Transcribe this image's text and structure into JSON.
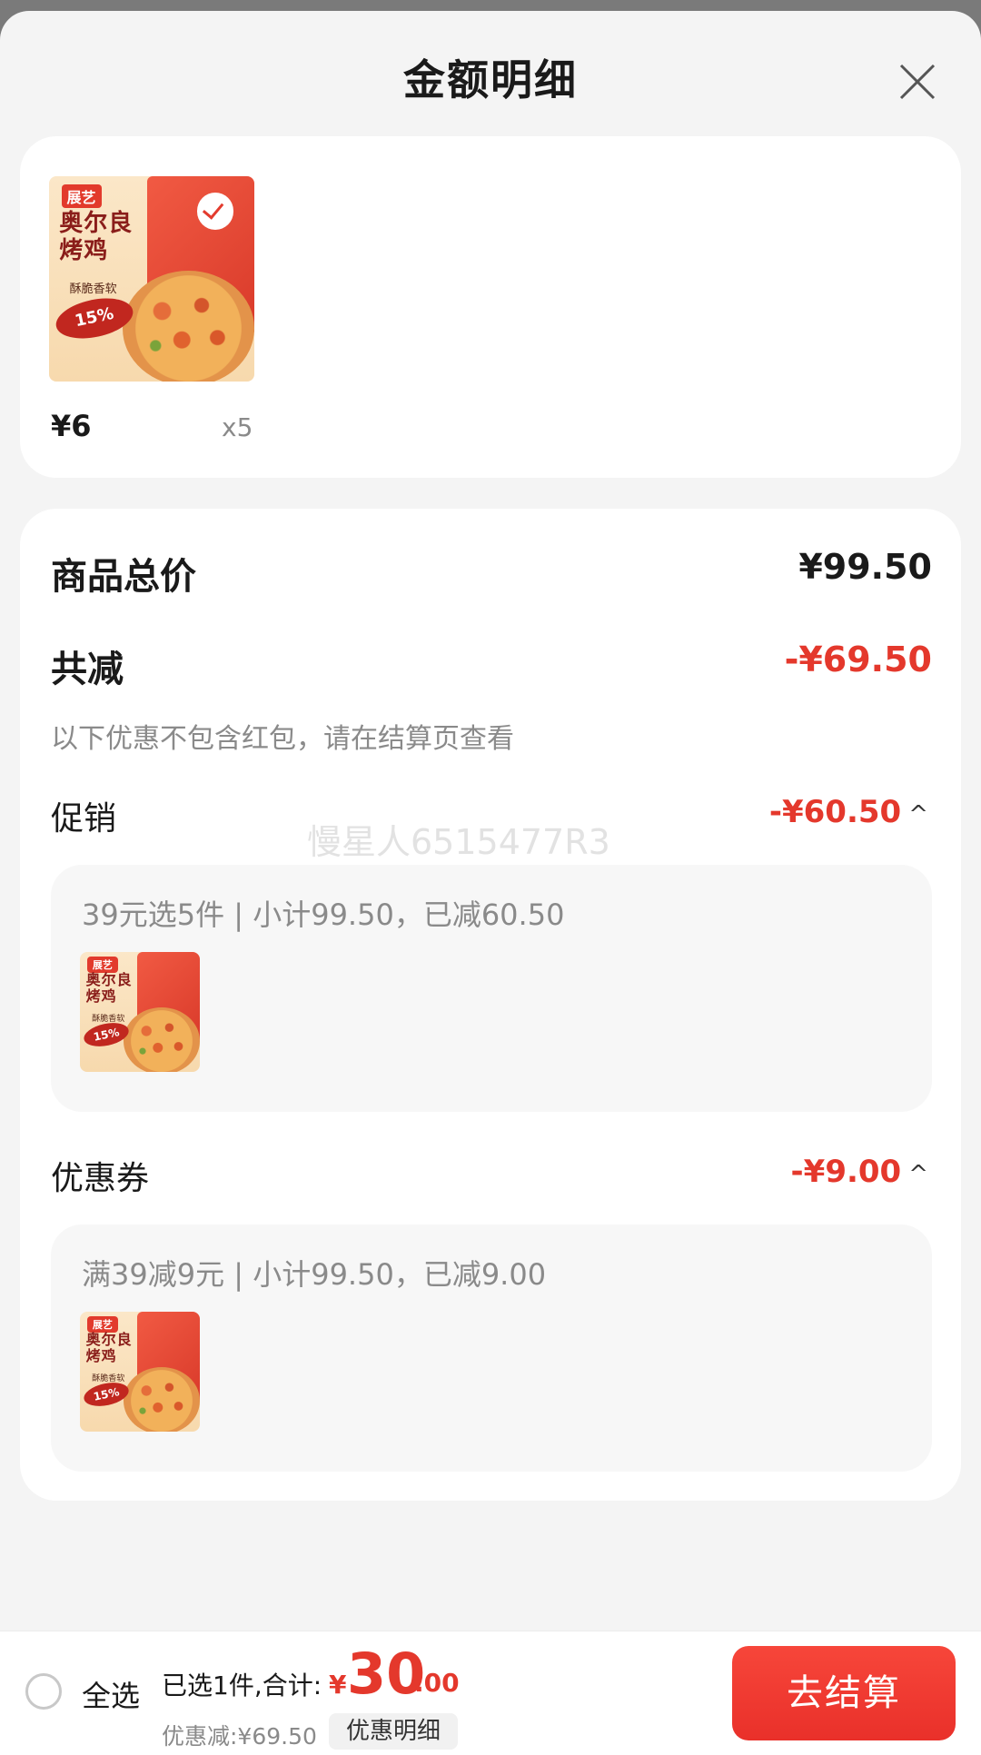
{
  "header": {
    "title": "金额明细",
    "close_icon": "close-icon"
  },
  "product": {
    "image": {
      "logo_text": "展艺",
      "title_line1": "奥尔良",
      "title_line2": "烤鸡",
      "subtitle": "酥脆香软",
      "badge": "15%"
    },
    "price": "¥6",
    "quantity": "x5"
  },
  "summary": {
    "total_label": "商品总价",
    "total_value": "¥99.50",
    "reduce_label": "共减",
    "reduce_value": "-¥69.50",
    "note": "以下优惠不包含红包，请在结算页查看",
    "watermark": "慢星人6515477R3",
    "sections": [
      {
        "label": "促销",
        "value": "-¥60.50",
        "chevron": "^",
        "detail": "39元选5件 | 小计99.50，已减60.50"
      },
      {
        "label": "优惠券",
        "value": "-¥9.00",
        "chevron": "^",
        "detail": "满39减9元 | 小计99.50，已减9.00"
      }
    ]
  },
  "bottom_bar": {
    "select_all": "全选",
    "selected_text": "已选1件,合计:",
    "currency": "¥",
    "total_int": "30",
    "total_dec": ".00",
    "discount_text": "优惠减:¥69.50",
    "detail_button": "优惠明细",
    "checkout_button": "去结算"
  },
  "colors": {
    "accent": "#e4382c",
    "background": "#f4f4f4",
    "card": "#ffffff"
  }
}
